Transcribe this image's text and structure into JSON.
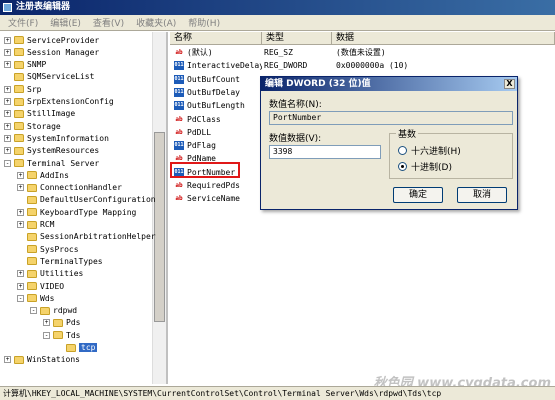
{
  "window": {
    "title": "注册表编辑器"
  },
  "menu": [
    "文件(F)",
    "编辑(E)",
    "查看(V)",
    "收藏夹(A)",
    "帮助(H)"
  ],
  "tree": [
    {
      "label": "ServiceProvider",
      "level": 0,
      "expander": "+"
    },
    {
      "label": "Session Manager",
      "level": 0,
      "expander": "+"
    },
    {
      "label": "SNMP",
      "level": 0,
      "expander": "+"
    },
    {
      "label": "SQMServiceList",
      "level": 0,
      "expander": ""
    },
    {
      "label": "Srp",
      "level": 0,
      "expander": "+"
    },
    {
      "label": "SrpExtensionConfig",
      "level": 0,
      "expander": "+"
    },
    {
      "label": "StillImage",
      "level": 0,
      "expander": "+"
    },
    {
      "label": "Storage",
      "level": 0,
      "expander": "+"
    },
    {
      "label": "SystemInformation",
      "level": 0,
      "expander": "+"
    },
    {
      "label": "SystemResources",
      "level": 0,
      "expander": "+"
    },
    {
      "label": "Terminal Server",
      "level": 0,
      "expander": "-"
    },
    {
      "label": "AddIns",
      "level": 1,
      "expander": "+"
    },
    {
      "label": "ConnectionHandler",
      "level": 1,
      "expander": "+"
    },
    {
      "label": "DefaultUserConfiguration",
      "level": 1,
      "expander": ""
    },
    {
      "label": "KeyboardType Mapping",
      "level": 1,
      "expander": "+"
    },
    {
      "label": "RCM",
      "level": 1,
      "expander": "+"
    },
    {
      "label": "SessionArbitrationHelper",
      "level": 1,
      "expander": ""
    },
    {
      "label": "SysProcs",
      "level": 1,
      "expander": ""
    },
    {
      "label": "TerminalTypes",
      "level": 1,
      "expander": ""
    },
    {
      "label": "Utilities",
      "level": 1,
      "expander": "+"
    },
    {
      "label": "VIDEO",
      "level": 1,
      "expander": "+"
    },
    {
      "label": "Wds",
      "level": 1,
      "expander": "-"
    },
    {
      "label": "rdpwd",
      "level": 2,
      "expander": "-"
    },
    {
      "label": "Pds",
      "level": 3,
      "expander": "+"
    },
    {
      "label": "Tds",
      "level": 3,
      "expander": "-"
    },
    {
      "label": "tcp",
      "level": 4,
      "expander": "",
      "selected": true
    },
    {
      "label": "WinStations",
      "level": 0,
      "expander": "+"
    }
  ],
  "list": {
    "headers": [
      "名称",
      "类型",
      "数据"
    ],
    "rows": [
      {
        "icon": "ab",
        "name": "(默认)",
        "type": "REG_SZ",
        "data": "(数值未设置)"
      },
      {
        "icon": "dw",
        "name": "InteractiveDelay",
        "type": "REG_DWORD",
        "data": "0x0000000a (10)"
      },
      {
        "icon": "dw",
        "name": "OutBufCount",
        "type": "",
        "data": ""
      },
      {
        "icon": "dw",
        "name": "OutBufDelay",
        "type": "",
        "data": ""
      },
      {
        "icon": "dw",
        "name": "OutBufLength",
        "type": "",
        "data": ""
      },
      {
        "icon": "ab",
        "name": "PdClass",
        "type": "",
        "data": ""
      },
      {
        "icon": "ab",
        "name": "PdDLL",
        "type": "",
        "data": ""
      },
      {
        "icon": "dw",
        "name": "PdFlag",
        "type": "",
        "data": ""
      },
      {
        "icon": "ab",
        "name": "PdName",
        "type": "",
        "data": ""
      },
      {
        "icon": "dw",
        "name": "PortNumber",
        "type": "",
        "data": ""
      },
      {
        "icon": "ab",
        "name": "RequiredPds",
        "type": "",
        "data": ""
      },
      {
        "icon": "ab",
        "name": "ServiceName",
        "type": "",
        "data": ""
      }
    ]
  },
  "dialog": {
    "title": "编辑 DWORD (32 位)值",
    "close": "X",
    "name_label": "数值名称(N):",
    "name_value": "PortNumber",
    "data_label": "数值数据(V):",
    "data_value": "3398",
    "base_title": "基数",
    "hex_label": "十六进制(H)",
    "dec_label": "十进制(D)",
    "selected_base": "decimal",
    "ok": "确定",
    "cancel": "取消"
  },
  "status": "计算机\\HKEY_LOCAL_MACHINE\\SYSTEM\\CurrentControlSet\\Control\\Terminal Server\\Wds\\rdpwd\\Tds\\tcp",
  "watermark": "秋色园 www.cyqdata.com"
}
